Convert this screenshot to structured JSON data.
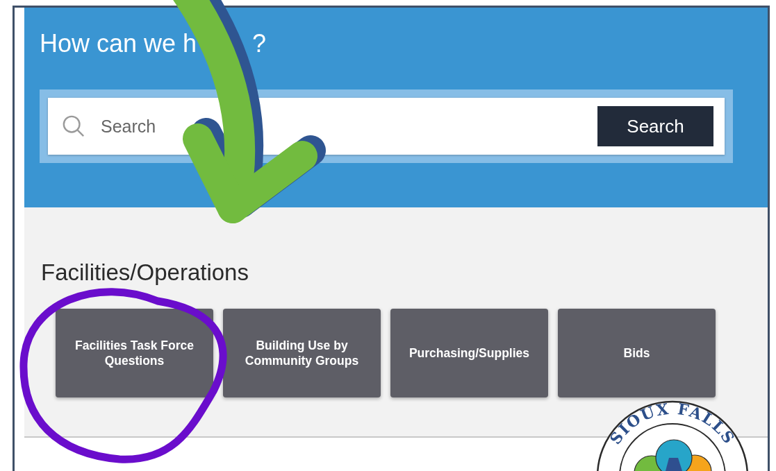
{
  "header": {
    "title_parts": [
      "How can we h",
      "?"
    ],
    "search": {
      "placeholder": "Search",
      "button": "Search"
    }
  },
  "section": {
    "heading": "Facilities/Operations",
    "cards": [
      {
        "label": "Facilities Task Force Questions"
      },
      {
        "label": "Building Use by Community Groups"
      },
      {
        "label": "Purchasing/Supplies"
      },
      {
        "label": "Bids"
      }
    ]
  },
  "logo": {
    "text": "SIOUX FALLS"
  }
}
